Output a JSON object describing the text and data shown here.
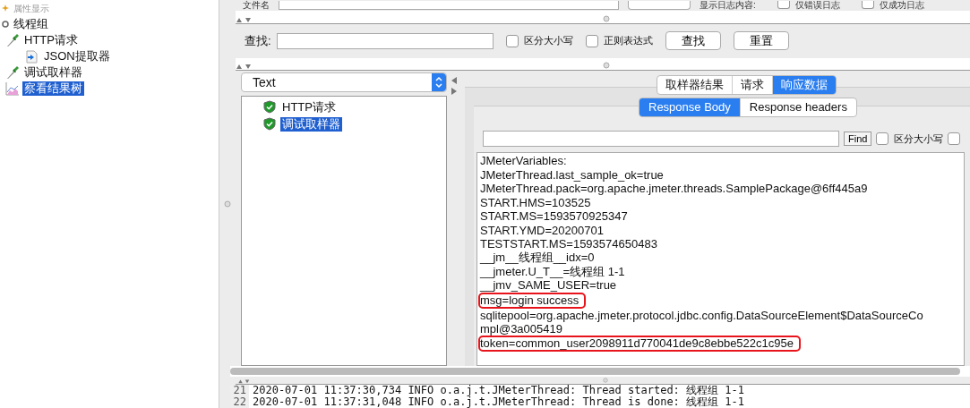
{
  "tree": [
    {
      "label": "属性显示",
      "kind": "property",
      "selected": false
    },
    {
      "label": "线程组",
      "kind": "threadgroup",
      "selected": false,
      "children": [
        {
          "label": "HTTP请求",
          "kind": "sampler",
          "selected": false,
          "children": [
            {
              "label": "JSON提取器",
              "kind": "extractor",
              "selected": false
            }
          ]
        },
        {
          "label": "调试取样器",
          "kind": "sampler",
          "selected": false
        },
        {
          "label": "察看结果树",
          "kind": "listener",
          "selected": true
        }
      ]
    }
  ],
  "file_row": {
    "label": "文件名",
    "log_label": "显示日志内容:",
    "checkboxes": [
      {
        "label": "仅错误日志",
        "checked": false
      },
      {
        "label": "仅成功日志",
        "checked": false
      }
    ]
  },
  "search": {
    "label": "查找:",
    "checkboxes": [
      {
        "label": "区分大小写",
        "checked": false
      },
      {
        "label": "正则表达式",
        "checked": false
      }
    ],
    "buttons": [
      "查找",
      "重置"
    ]
  },
  "renderer": {
    "value": "Text"
  },
  "results": [
    {
      "label": "HTTP请求",
      "success": true,
      "selected": false
    },
    {
      "label": "调试取样器",
      "success": true,
      "selected": true
    }
  ],
  "result_tabs": [
    {
      "label": "取样器结果",
      "selected": false
    },
    {
      "label": "请求",
      "selected": false
    },
    {
      "label": "响应数据",
      "selected": true
    }
  ],
  "response_tabs": [
    {
      "label": "Response Body",
      "selected": true
    },
    {
      "label": "Response headers",
      "selected": false
    }
  ],
  "response_find": {
    "button": "Find",
    "checkboxes": [
      {
        "label": "区分大小写",
        "checked": false
      },
      {
        "checked": false
      }
    ]
  },
  "response_lines": [
    {
      "text": "JMeterVariables:",
      "highlighted": false
    },
    {
      "text": "JMeterThread.last_sample_ok=true",
      "highlighted": false
    },
    {
      "text": "JMeterThread.pack=org.apache.jmeter.threads.SamplePackage@6ff445a9",
      "highlighted": false
    },
    {
      "text": "START.HMS=103525",
      "highlighted": false
    },
    {
      "text": "START.MS=1593570925347",
      "highlighted": false
    },
    {
      "text": "START.YMD=20200701",
      "highlighted": false
    },
    {
      "text": "TESTSTART.MS=1593574650483",
      "highlighted": false
    },
    {
      "text": "__jm__线程组__idx=0",
      "highlighted": false
    },
    {
      "text": "__jmeter.U_T__=线程组 1-1",
      "highlighted": false
    },
    {
      "text": "__jmv_SAME_USER=true",
      "highlighted": false
    },
    {
      "text": "msg=login success",
      "highlighted": true
    },
    {
      "text": "sqlitepool=org.apache.jmeter.protocol.jdbc.config.DataSourceElement$DataSourceCo",
      "highlighted": false
    },
    {
      "text": "mpl@3a005419",
      "highlighted": false
    },
    {
      "text": "token=common_user2098911d770041de9c8ebbe522c1c95e",
      "highlighted": true
    }
  ],
  "log": [
    {
      "number": "21",
      "text": "2020-07-01 11:37:30,734 INFO o.a.j.t.JMeterThread: Thread started: 线程组 1-1"
    },
    {
      "number": "22",
      "text": "2020-07-01 11:37:31,048 INFO o.a.j.t.JMeterThread: Thread is done: 线程组 1-1"
    }
  ]
}
